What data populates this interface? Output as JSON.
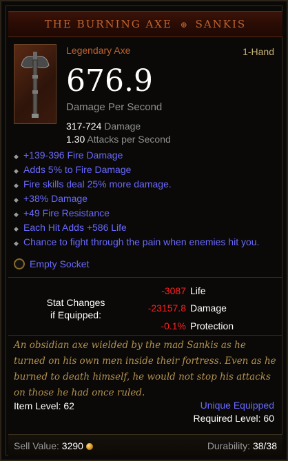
{
  "header": {
    "title": "THE BURNING AXE",
    "title_emblem": "⊕",
    "title_tail": "SANKIS"
  },
  "item": {
    "type": "Legendary Axe",
    "slot": "1-Hand",
    "dps": "676.9",
    "dps_label": "Damage Per Second",
    "damage_value": "317-724",
    "damage_label": "Damage",
    "aps_value": "1.30",
    "aps_label": "Attacks per Second",
    "icon": "axe-icon"
  },
  "properties": [
    "+139-396 Fire Damage",
    "Adds 5% to Fire Damage",
    "Fire skills deal 25% more damage.",
    "+38% Damage",
    "+49 Fire Resistance",
    "Each Hit Adds +586 Life",
    "Chance to fight through the pain when enemies hit you."
  ],
  "socket": {
    "label": "Empty Socket"
  },
  "stat_changes": {
    "label_line1": "Stat Changes",
    "label_line2": "if Equipped:",
    "rows": [
      {
        "value": "-3087",
        "name": "Life"
      },
      {
        "value": "-23157.8",
        "name": "Damage"
      },
      {
        "value": "-0.1%",
        "name": "Protection"
      }
    ]
  },
  "flavor": "An obsidian axe wielded by the mad Sankis as he turned on his own men inside their fortress. Even as he burned to death himself, he would not stop his attacks on those he had once ruled.",
  "meta": {
    "item_level": "Item Level: 62",
    "unique_equipped": "Unique Equipped",
    "required_level": "Required Level: 60"
  },
  "footer": {
    "sell_label": "Sell Value:",
    "sell_value": "3290",
    "durability_label": "Durability:",
    "durability_value": "38/38"
  },
  "colors": {
    "title": "#bf642f",
    "magic": "#6969ff",
    "negative": "#ff2020",
    "flavor": "#b39150"
  }
}
